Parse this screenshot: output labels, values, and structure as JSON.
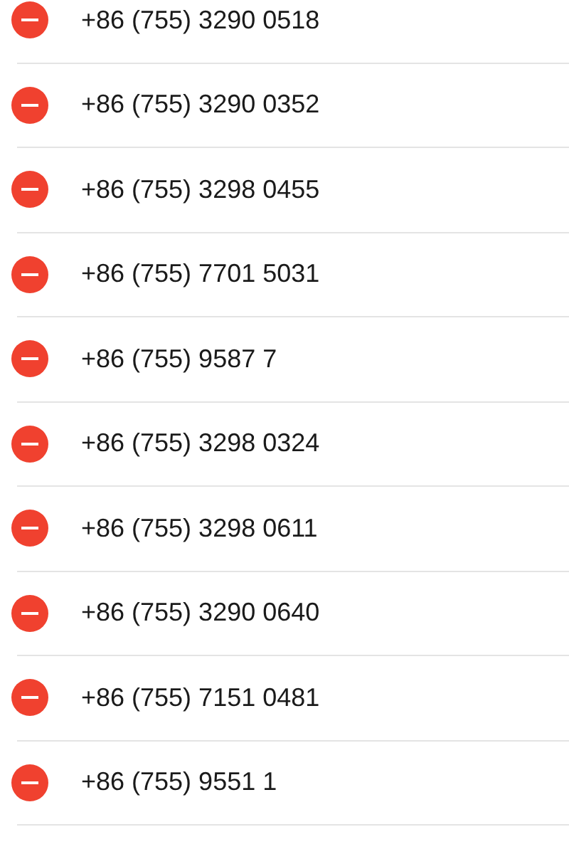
{
  "blocked_numbers": [
    {
      "number": "+86 (755) 3290 0518"
    },
    {
      "number": "+86 (755) 3290 0352"
    },
    {
      "number": "+86 (755) 3298 0455"
    },
    {
      "number": "+86 (755) 7701 5031"
    },
    {
      "number": "+86 (755) 9587 7"
    },
    {
      "number": "+86 (755) 3298 0324"
    },
    {
      "number": "+86 (755) 3298 0611"
    },
    {
      "number": "+86 (755) 3290 0640"
    },
    {
      "number": "+86 (755) 7151 0481"
    },
    {
      "number": "+86 (755) 9551 1"
    }
  ]
}
